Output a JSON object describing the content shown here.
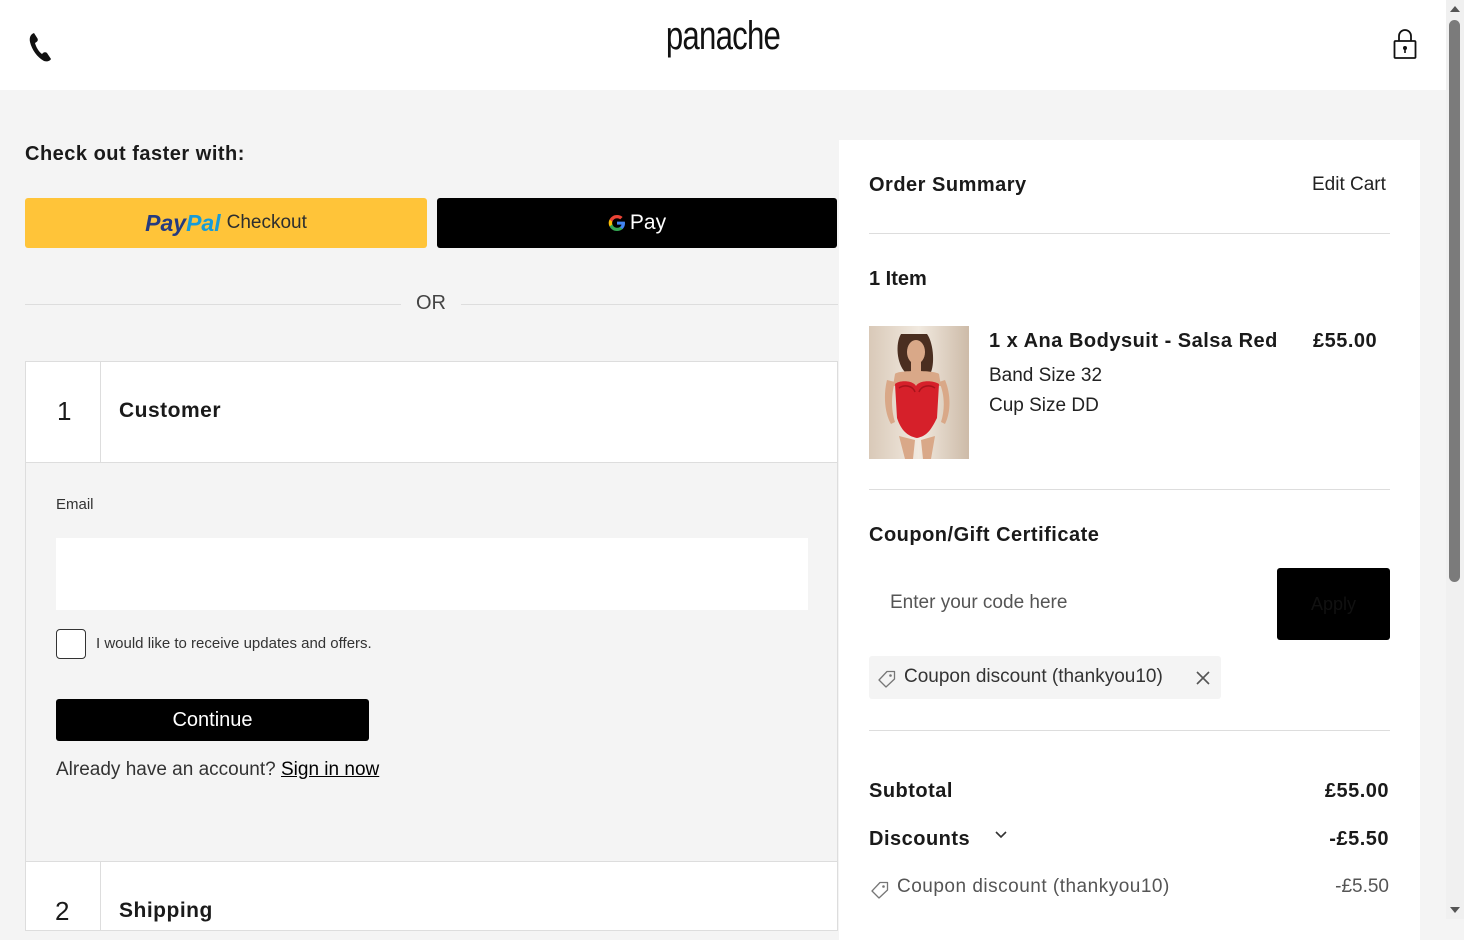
{
  "header": {
    "logo": "panache"
  },
  "express": {
    "title": "Check out faster with:",
    "paypal_pay": "Pay",
    "paypal_pal": "Pal",
    "paypal_checkout": "Checkout",
    "gpay_label": "Pay",
    "or_text": "OR"
  },
  "steps": [
    {
      "number": "1",
      "title": "Customer"
    },
    {
      "number": "2",
      "title": "Shipping"
    }
  ],
  "customer": {
    "email_label": "Email",
    "email_value": "",
    "newsletter_label": "I would like to receive updates and offers.",
    "newsletter_checked": false,
    "continue_label": "Continue",
    "account_prompt": "Already have an account?",
    "signin_label": "Sign in now"
  },
  "summary": {
    "title": "Order Summary",
    "edit_cart": "Edit Cart",
    "items_count": "1 Item",
    "product": {
      "name": "1 x Ana Bodysuit - Salsa Red",
      "price": "£55.00",
      "band": "Band Size 32",
      "cup": "Cup Size DD"
    },
    "coupon": {
      "title": "Coupon/Gift Certificate",
      "placeholder": "Enter your code here",
      "apply_label": "Apply",
      "applied": "Coupon discount (thankyou10)"
    },
    "subtotal_label": "Subtotal",
    "subtotal_value": "£55.00",
    "discounts_label": "Discounts",
    "discounts_value": "-£5.50",
    "discount_detail_label": "Coupon discount (thankyou10)",
    "discount_detail_value": "-£5.50"
  },
  "colors": {
    "paypal_yellow": "#ffc439",
    "paypal_dark_blue": "#253b80",
    "paypal_light_blue": "#179bd7",
    "page_bg": "#f4f4f4",
    "button_black": "#000000"
  },
  "icons": {
    "phone": "phone-icon",
    "lock": "lock-icon",
    "tag": "tag-icon",
    "close": "close-icon",
    "chevron": "chevron-down-icon",
    "google": "google-g-icon"
  }
}
